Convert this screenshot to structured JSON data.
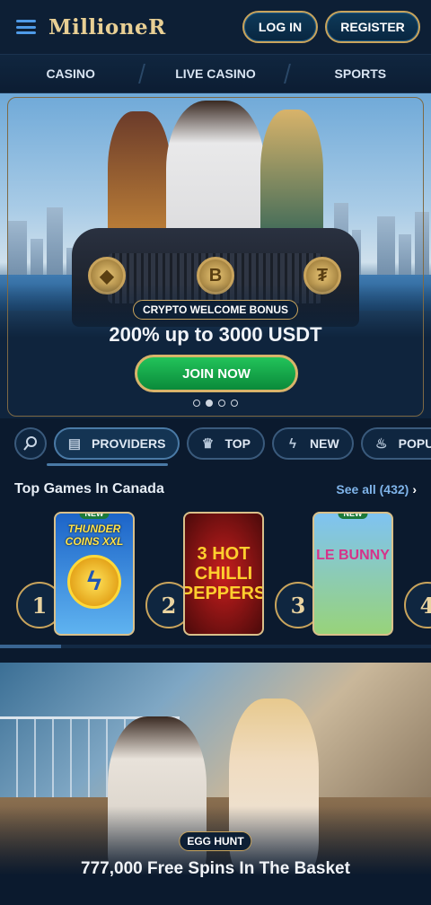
{
  "header": {
    "logo": "MillioneR",
    "login_label": "LOG IN",
    "register_label": "REGISTER",
    "icons": [
      "menu-icon"
    ]
  },
  "nav": {
    "items": [
      {
        "label": "CASINO"
      },
      {
        "label": "LIVE CASINO"
      },
      {
        "label": "SPORTS"
      }
    ]
  },
  "hero": {
    "tag": "CRYPTO WELCOME BONUS",
    "title": "200% up to 3000 USDT",
    "cta": "JOIN NOW",
    "coins": [
      "ethereum-coin",
      "bitcoin-coin",
      "tether-coin"
    ],
    "slides_total": 4,
    "active_slide": 2
  },
  "filters": {
    "items": [
      {
        "label": "PROVIDERS",
        "icon": "book-icon"
      },
      {
        "label": "TOP",
        "icon": "crown-icon"
      },
      {
        "label": "NEW",
        "icon": "lightning-icon"
      },
      {
        "label": "POPUL",
        "icon": "fire-icon"
      }
    ],
    "search_icon": "search-icon"
  },
  "top_games": {
    "title": "Top Games In Canada",
    "see_all": "See all (432)",
    "games": [
      {
        "rank": "1",
        "name": "THUNDER COINS XXL",
        "badge": "NEW"
      },
      {
        "rank": "2",
        "name": "3 HOT CHILLI PEPPERS",
        "badge": ""
      },
      {
        "rank": "3",
        "name": "LE BUNNY",
        "badge": "NEW"
      },
      {
        "rank": "4"
      }
    ]
  },
  "promo": {
    "tag": "EGG HUNT",
    "title": "777,000 Free Spins In The Basket"
  },
  "colors": {
    "background": "#0b1a2e",
    "gold_accent": "#c9a45c",
    "link_blue": "#7fb4ea",
    "cta_green": "#12a545"
  }
}
